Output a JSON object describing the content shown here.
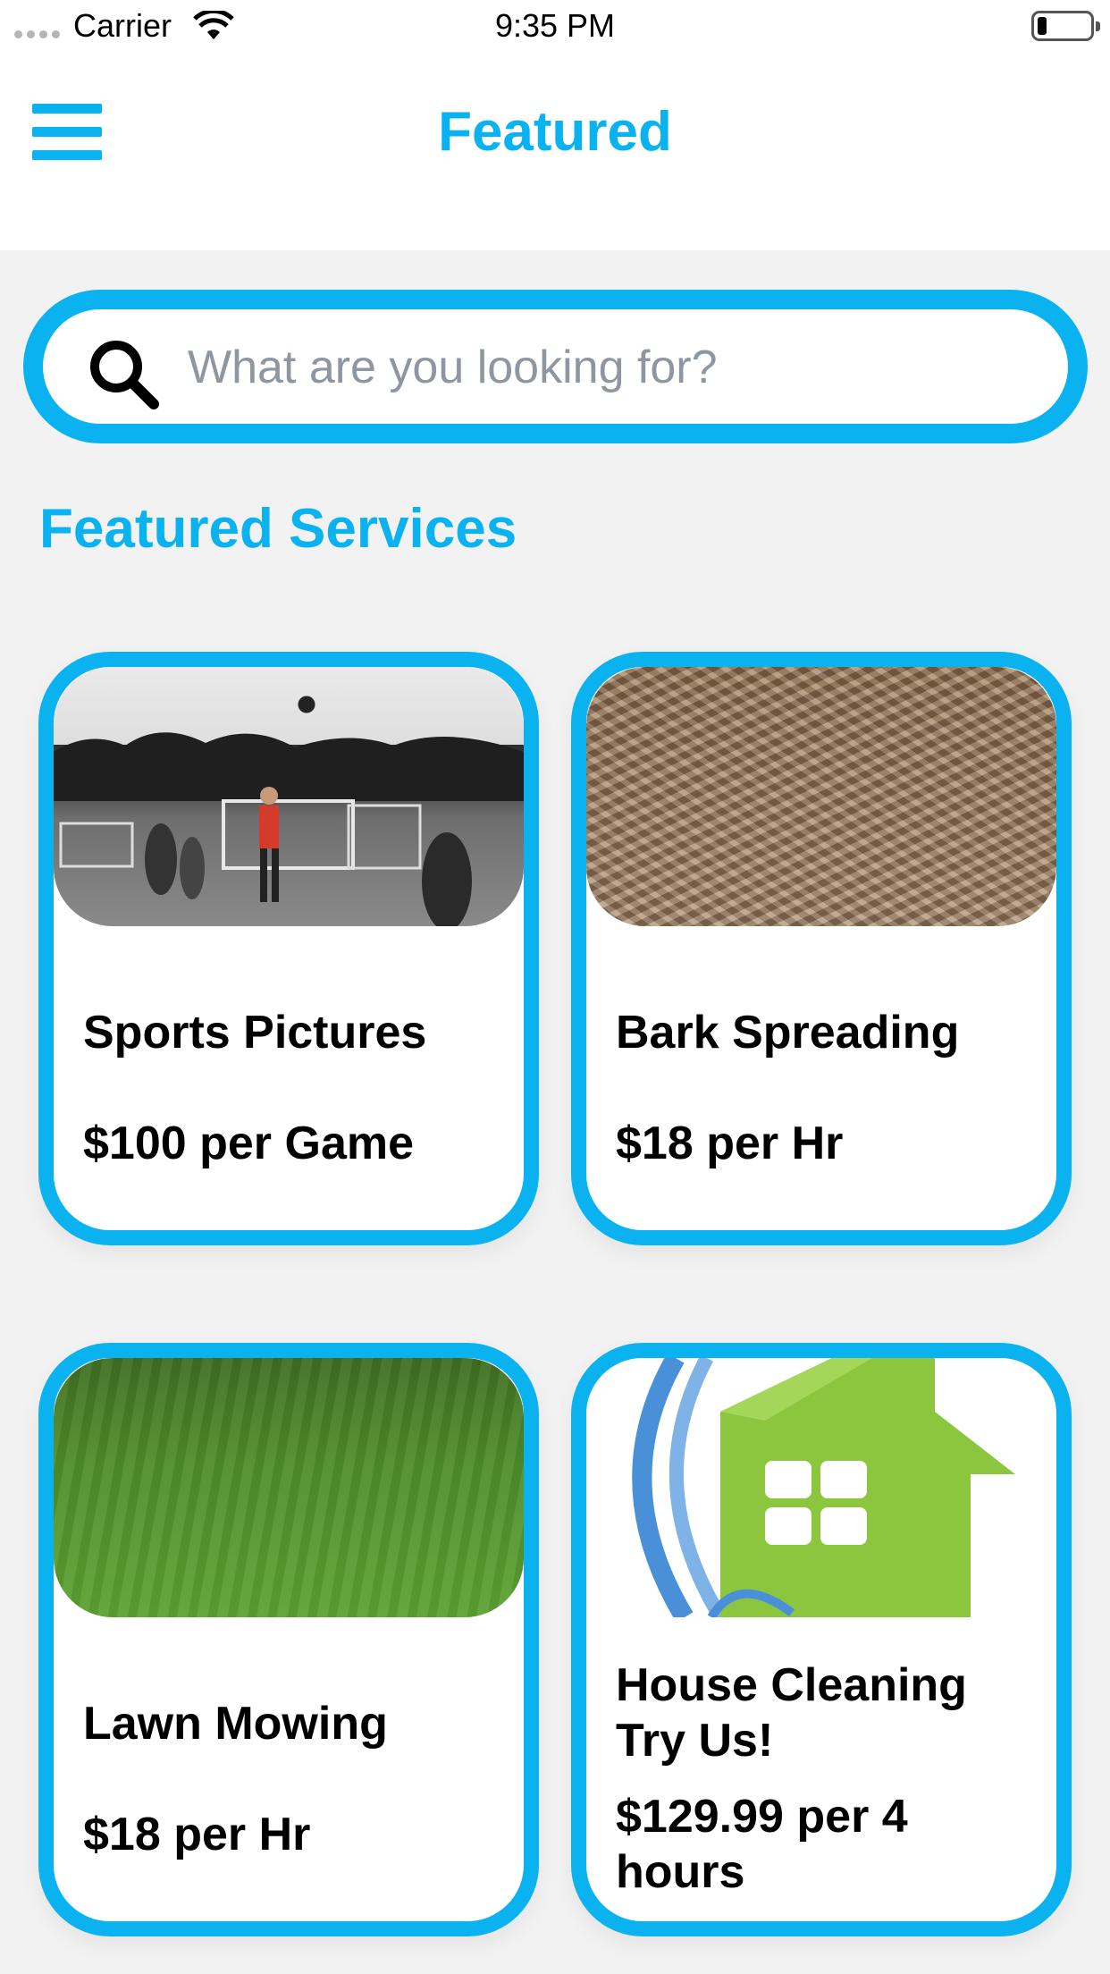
{
  "status_bar": {
    "carrier": "Carrier",
    "time": "9:35 PM"
  },
  "nav": {
    "title": "Featured",
    "menu_icon": "hamburger-menu-icon"
  },
  "search": {
    "placeholder": "What are you looking for?",
    "icon": "search-icon",
    "value": ""
  },
  "section": {
    "title": "Featured Services"
  },
  "services": [
    {
      "title": "Sports Pictures",
      "price": "$100 per Game",
      "image": "soccer-game-photo"
    },
    {
      "title": "Bark Spreading",
      "price": "$18 per Hr",
      "image": "bark-mulch-photo"
    },
    {
      "title": "Lawn Mowing",
      "price": "$18 per Hr",
      "image": "grass-lawn-photo"
    },
    {
      "title": "House Cleaning Try Us!",
      "price": "$129.99 per 4 hours",
      "image": "house-logo"
    }
  ],
  "colors": {
    "accent": "#0ab2ef",
    "background": "#f2f2f3",
    "card": "#ffffff",
    "placeholder": "#8e96a1"
  }
}
